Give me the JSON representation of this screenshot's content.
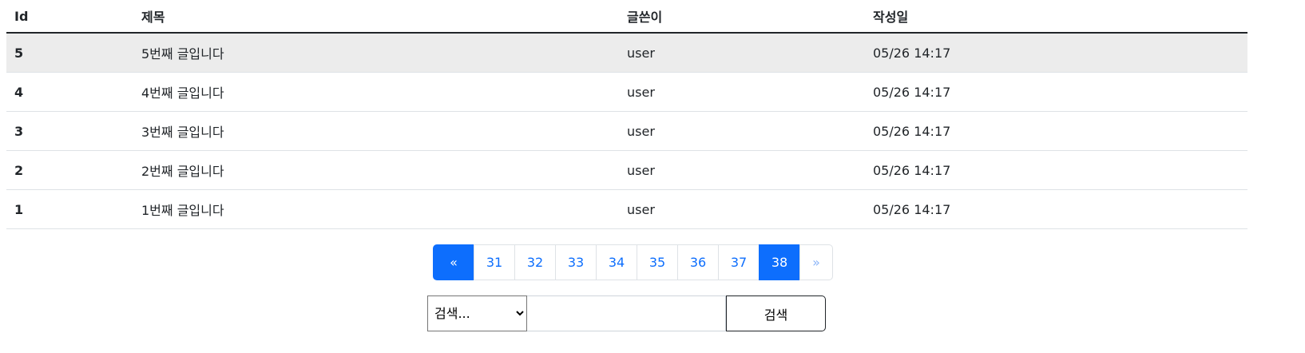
{
  "table": {
    "headers": [
      "Id",
      "제목",
      "글쓴이",
      "작성일"
    ],
    "rows": [
      {
        "id": "5",
        "title": "5번째 글입니다",
        "author": "user",
        "date": "05/26 14:17"
      },
      {
        "id": "4",
        "title": "4번째 글입니다",
        "author": "user",
        "date": "05/26 14:17"
      },
      {
        "id": "3",
        "title": "3번째 글입니다",
        "author": "user",
        "date": "05/26 14:17"
      },
      {
        "id": "2",
        "title": "2번째 글입니다",
        "author": "user",
        "date": "05/26 14:17"
      },
      {
        "id": "1",
        "title": "1번째 글입니다",
        "author": "user",
        "date": "05/26 14:17"
      }
    ]
  },
  "pagination": {
    "prev": "«",
    "pages": [
      "31",
      "32",
      "33",
      "34",
      "35",
      "36",
      "37",
      "38"
    ],
    "current": "38",
    "next": "»"
  },
  "search": {
    "select_value": "검색...",
    "input_value": "",
    "button": "검색"
  },
  "colors": {
    "accent": "#0d6efd",
    "highlight_row": "#ececec"
  }
}
